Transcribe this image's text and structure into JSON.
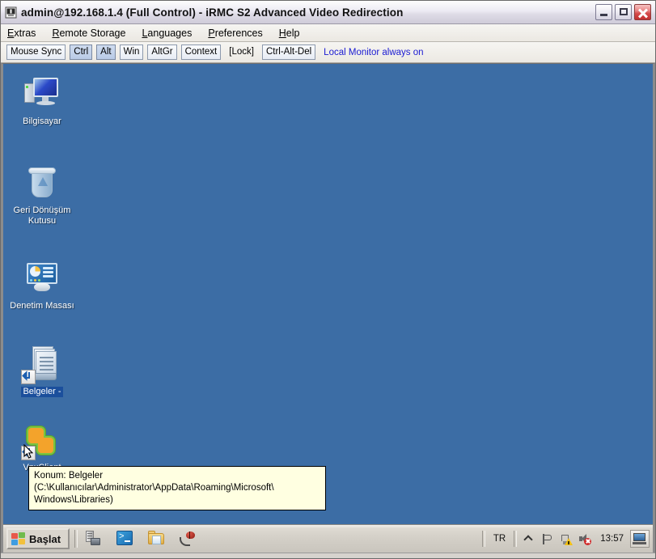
{
  "window": {
    "title": "admin@192.168.1.4 (Full Control) - iRMC S2 Advanced Video Redirection",
    "icon": "video-redirection-icon",
    "minimize_label": "minimize-icon",
    "maximize_label": "maximize-icon",
    "close_label": "close-icon"
  },
  "menu": {
    "items": [
      {
        "label": "Extras",
        "mnemonic": "E",
        "rest": "xtras"
      },
      {
        "label": "Remote Storage",
        "mnemonic": "R",
        "rest": "emote Storage"
      },
      {
        "label": "Languages",
        "mnemonic": "L",
        "rest": "anguages"
      },
      {
        "label": "Preferences",
        "mnemonic": "P",
        "rest": "references"
      },
      {
        "label": "Help",
        "mnemonic": "H",
        "rest": "elp"
      }
    ]
  },
  "toolbar": {
    "buttons": [
      {
        "label": "Mouse Sync",
        "state": "normal"
      },
      {
        "label": "Ctrl",
        "state": "pressed"
      },
      {
        "label": "Alt",
        "state": "pressed"
      },
      {
        "label": "Win",
        "state": "normal"
      },
      {
        "label": "AltGr",
        "state": "normal"
      },
      {
        "label": "Context",
        "state": "normal"
      },
      {
        "label": "[Lock]",
        "state": "flat"
      },
      {
        "label": "Ctrl-Alt-Del",
        "state": "normal"
      }
    ],
    "status_link": "Local Monitor always on",
    "status_link_color": "#1a1ad2"
  },
  "desktop": {
    "background_color": "#3c6da5",
    "icons": [
      {
        "name": "Bilgisayar",
        "icon": "computer-icon",
        "selected": false,
        "shortcut": false
      },
      {
        "name": "Geri Dönüşüm Kutusu",
        "icon": "recycle-bin-icon",
        "selected": false,
        "shortcut": false
      },
      {
        "name": "Denetim Masası",
        "icon": "control-panel-icon",
        "selected": false,
        "shortcut": false
      },
      {
        "name": "Belgeler -",
        "icon": "documents-icon",
        "selected": true,
        "shortcut": true
      },
      {
        "name": "VpxClient",
        "icon": "vpxclient-icon",
        "selected": false,
        "shortcut": true
      }
    ],
    "tooltip": {
      "line1": "Konum: Belgeler (C:\\Kullanıcılar\\Administrator\\AppData\\Roaming\\Microsoft\\",
      "line2": "Windows\\Libraries)"
    },
    "cursor": "arrow-cursor"
  },
  "taskbar": {
    "start_label": "Başlat",
    "start_icon": "windows-flag-icon",
    "quick_launch": [
      {
        "icon": "server-manager-icon",
        "title": "Server Manager"
      },
      {
        "icon": "powershell-icon",
        "title": "Windows PowerShell"
      },
      {
        "icon": "explorer-folder-icon",
        "title": "Windows Explorer"
      },
      {
        "icon": "bug-icon",
        "title": "Debug"
      }
    ],
    "tray": {
      "language": "TR",
      "icons": [
        {
          "icon": "show-hidden-icons-chevron-icon"
        },
        {
          "icon": "action-center-flag-icon"
        },
        {
          "icon": "network-warning-icon"
        },
        {
          "icon": "volume-muted-icon"
        }
      ],
      "clock": "13:57",
      "show_desktop_icon": "show-desktop-icon"
    }
  }
}
